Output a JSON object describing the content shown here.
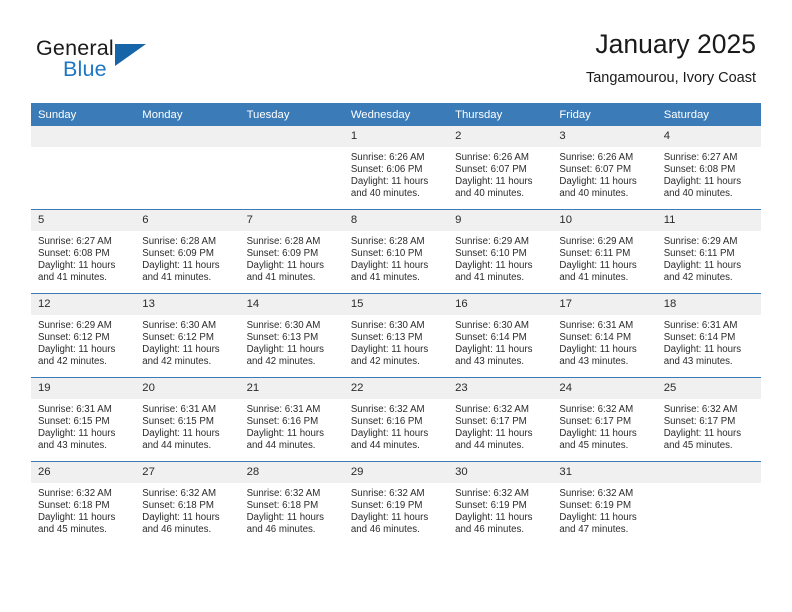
{
  "brand": {
    "name_top": "General",
    "name_bottom": "Blue",
    "accent_color": "#1f77c2",
    "triangle_color": "#1565a8",
    "triangle_icon": "triangle-flag-icon"
  },
  "header": {
    "title": "January 2025",
    "subtitle": "Tangamourou, Ivory Coast"
  },
  "theme": {
    "header_bg": "#3b7cb8",
    "header_text": "#ffffff",
    "daynum_bg": "#f0f0f0",
    "cell_text": "#2b2b2b",
    "divider": "#3b7cb8"
  },
  "calendar": {
    "weekday_headers": [
      "Sunday",
      "Monday",
      "Tuesday",
      "Wednesday",
      "Thursday",
      "Friday",
      "Saturday"
    ],
    "weeks": [
      [
        {
          "day": "",
          "empty": true,
          "sunrise": "",
          "sunset": "",
          "daylight": ""
        },
        {
          "day": "",
          "empty": true,
          "sunrise": "",
          "sunset": "",
          "daylight": ""
        },
        {
          "day": "",
          "empty": true,
          "sunrise": "",
          "sunset": "",
          "daylight": ""
        },
        {
          "day": "1",
          "empty": false,
          "sunrise": "Sunrise: 6:26 AM",
          "sunset": "Sunset: 6:06 PM",
          "daylight": "Daylight: 11 hours and 40 minutes."
        },
        {
          "day": "2",
          "empty": false,
          "sunrise": "Sunrise: 6:26 AM",
          "sunset": "Sunset: 6:07 PM",
          "daylight": "Daylight: 11 hours and 40 minutes."
        },
        {
          "day": "3",
          "empty": false,
          "sunrise": "Sunrise: 6:26 AM",
          "sunset": "Sunset: 6:07 PM",
          "daylight": "Daylight: 11 hours and 40 minutes."
        },
        {
          "day": "4",
          "empty": false,
          "sunrise": "Sunrise: 6:27 AM",
          "sunset": "Sunset: 6:08 PM",
          "daylight": "Daylight: 11 hours and 40 minutes."
        }
      ],
      [
        {
          "day": "5",
          "empty": false,
          "sunrise": "Sunrise: 6:27 AM",
          "sunset": "Sunset: 6:08 PM",
          "daylight": "Daylight: 11 hours and 41 minutes."
        },
        {
          "day": "6",
          "empty": false,
          "sunrise": "Sunrise: 6:28 AM",
          "sunset": "Sunset: 6:09 PM",
          "daylight": "Daylight: 11 hours and 41 minutes."
        },
        {
          "day": "7",
          "empty": false,
          "sunrise": "Sunrise: 6:28 AM",
          "sunset": "Sunset: 6:09 PM",
          "daylight": "Daylight: 11 hours and 41 minutes."
        },
        {
          "day": "8",
          "empty": false,
          "sunrise": "Sunrise: 6:28 AM",
          "sunset": "Sunset: 6:10 PM",
          "daylight": "Daylight: 11 hours and 41 minutes."
        },
        {
          "day": "9",
          "empty": false,
          "sunrise": "Sunrise: 6:29 AM",
          "sunset": "Sunset: 6:10 PM",
          "daylight": "Daylight: 11 hours and 41 minutes."
        },
        {
          "day": "10",
          "empty": false,
          "sunrise": "Sunrise: 6:29 AM",
          "sunset": "Sunset: 6:11 PM",
          "daylight": "Daylight: 11 hours and 41 minutes."
        },
        {
          "day": "11",
          "empty": false,
          "sunrise": "Sunrise: 6:29 AM",
          "sunset": "Sunset: 6:11 PM",
          "daylight": "Daylight: 11 hours and 42 minutes."
        }
      ],
      [
        {
          "day": "12",
          "empty": false,
          "sunrise": "Sunrise: 6:29 AM",
          "sunset": "Sunset: 6:12 PM",
          "daylight": "Daylight: 11 hours and 42 minutes."
        },
        {
          "day": "13",
          "empty": false,
          "sunrise": "Sunrise: 6:30 AM",
          "sunset": "Sunset: 6:12 PM",
          "daylight": "Daylight: 11 hours and 42 minutes."
        },
        {
          "day": "14",
          "empty": false,
          "sunrise": "Sunrise: 6:30 AM",
          "sunset": "Sunset: 6:13 PM",
          "daylight": "Daylight: 11 hours and 42 minutes."
        },
        {
          "day": "15",
          "empty": false,
          "sunrise": "Sunrise: 6:30 AM",
          "sunset": "Sunset: 6:13 PM",
          "daylight": "Daylight: 11 hours and 42 minutes."
        },
        {
          "day": "16",
          "empty": false,
          "sunrise": "Sunrise: 6:30 AM",
          "sunset": "Sunset: 6:14 PM",
          "daylight": "Daylight: 11 hours and 43 minutes."
        },
        {
          "day": "17",
          "empty": false,
          "sunrise": "Sunrise: 6:31 AM",
          "sunset": "Sunset: 6:14 PM",
          "daylight": "Daylight: 11 hours and 43 minutes."
        },
        {
          "day": "18",
          "empty": false,
          "sunrise": "Sunrise: 6:31 AM",
          "sunset": "Sunset: 6:14 PM",
          "daylight": "Daylight: 11 hours and 43 minutes."
        }
      ],
      [
        {
          "day": "19",
          "empty": false,
          "sunrise": "Sunrise: 6:31 AM",
          "sunset": "Sunset: 6:15 PM",
          "daylight": "Daylight: 11 hours and 43 minutes."
        },
        {
          "day": "20",
          "empty": false,
          "sunrise": "Sunrise: 6:31 AM",
          "sunset": "Sunset: 6:15 PM",
          "daylight": "Daylight: 11 hours and 44 minutes."
        },
        {
          "day": "21",
          "empty": false,
          "sunrise": "Sunrise: 6:31 AM",
          "sunset": "Sunset: 6:16 PM",
          "daylight": "Daylight: 11 hours and 44 minutes."
        },
        {
          "day": "22",
          "empty": false,
          "sunrise": "Sunrise: 6:32 AM",
          "sunset": "Sunset: 6:16 PM",
          "daylight": "Daylight: 11 hours and 44 minutes."
        },
        {
          "day": "23",
          "empty": false,
          "sunrise": "Sunrise: 6:32 AM",
          "sunset": "Sunset: 6:17 PM",
          "daylight": "Daylight: 11 hours and 44 minutes."
        },
        {
          "day": "24",
          "empty": false,
          "sunrise": "Sunrise: 6:32 AM",
          "sunset": "Sunset: 6:17 PM",
          "daylight": "Daylight: 11 hours and 45 minutes."
        },
        {
          "day": "25",
          "empty": false,
          "sunrise": "Sunrise: 6:32 AM",
          "sunset": "Sunset: 6:17 PM",
          "daylight": "Daylight: 11 hours and 45 minutes."
        }
      ],
      [
        {
          "day": "26",
          "empty": false,
          "sunrise": "Sunrise: 6:32 AM",
          "sunset": "Sunset: 6:18 PM",
          "daylight": "Daylight: 11 hours and 45 minutes."
        },
        {
          "day": "27",
          "empty": false,
          "sunrise": "Sunrise: 6:32 AM",
          "sunset": "Sunset: 6:18 PM",
          "daylight": "Daylight: 11 hours and 46 minutes."
        },
        {
          "day": "28",
          "empty": false,
          "sunrise": "Sunrise: 6:32 AM",
          "sunset": "Sunset: 6:18 PM",
          "daylight": "Daylight: 11 hours and 46 minutes."
        },
        {
          "day": "29",
          "empty": false,
          "sunrise": "Sunrise: 6:32 AM",
          "sunset": "Sunset: 6:19 PM",
          "daylight": "Daylight: 11 hours and 46 minutes."
        },
        {
          "day": "30",
          "empty": false,
          "sunrise": "Sunrise: 6:32 AM",
          "sunset": "Sunset: 6:19 PM",
          "daylight": "Daylight: 11 hours and 46 minutes."
        },
        {
          "day": "31",
          "empty": false,
          "sunrise": "Sunrise: 6:32 AM",
          "sunset": "Sunset: 6:19 PM",
          "daylight": "Daylight: 11 hours and 47 minutes."
        },
        {
          "day": "",
          "empty": true,
          "sunrise": "",
          "sunset": "",
          "daylight": ""
        }
      ]
    ]
  }
}
